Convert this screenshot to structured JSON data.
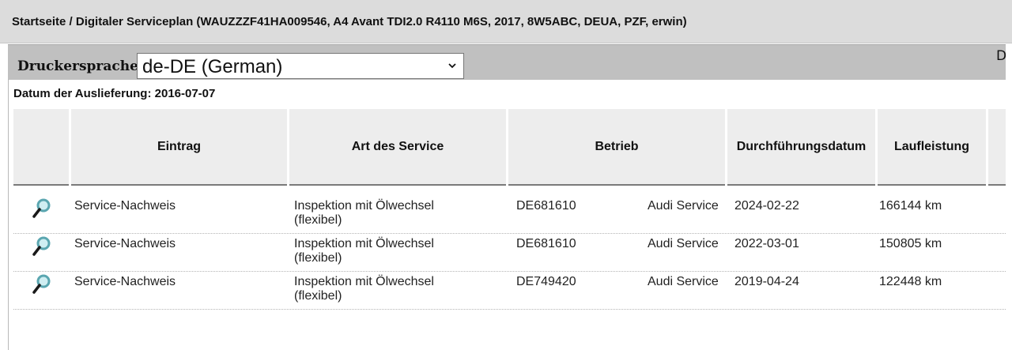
{
  "breadcrumb": "Startseite / Digitaler Serviceplan (WAUZZZF41HA009546, A4 Avant TDI2.0 R4110 M6S, 2017, 8W5ABC, DEUA, PZF, erwin)",
  "print_language": {
    "label": "Druckersprache:",
    "selected": "de-DE (German)"
  },
  "right_cut_text": "D",
  "delivery_date": "Datum der Auslieferung: 2016-07-07",
  "table": {
    "columns": [
      "",
      "Eintrag",
      "Art des Service",
      "Betrieb",
      "Durchführungsdatum",
      "Laufleistung"
    ],
    "rows": [
      {
        "entry": "Service-Nachweis",
        "service_l1": "Inspektion mit Ölwechsel",
        "service_l2": "(flexibel)",
        "dealer_code": "DE681610",
        "dealer_name": "Audi Service",
        "date": "2024-02-22",
        "mileage": "166144 km"
      },
      {
        "entry": "Service-Nachweis",
        "service_l1": "Inspektion mit Ölwechsel",
        "service_l2": "(flexibel)",
        "dealer_code": "DE681610",
        "dealer_name": "Audi Service",
        "date": "2022-03-01",
        "mileage": "150805 km"
      },
      {
        "entry": "Service-Nachweis",
        "service_l1": "Inspektion mit Ölwechsel",
        "service_l2": "(flexibel)",
        "dealer_code": "DE749420",
        "dealer_name": "Audi Service",
        "date": "2019-04-24",
        "mileage": "122448 km"
      }
    ]
  },
  "icons": {
    "detail": "magnifier-icon",
    "dropdown": "chevron-down-icon"
  },
  "colors": {
    "magnifier_glass": "#5aa6b0",
    "magnifier_handle": "#1a1a1a"
  }
}
